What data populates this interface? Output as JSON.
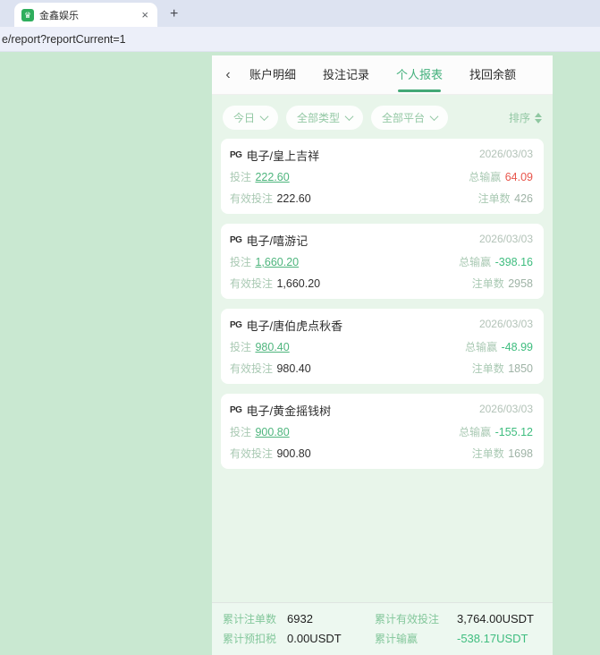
{
  "browser": {
    "tab_title": "金鑫娱乐",
    "favicon_glyph": "♛",
    "close_label": "×",
    "new_tab_label": "+",
    "url": "e/report?reportCurrent=1"
  },
  "header": {
    "back_icon": "‹",
    "tabs": [
      {
        "label": "账户明细"
      },
      {
        "label": "投注记录"
      },
      {
        "label": "个人报表"
      },
      {
        "label": "找回余额"
      }
    ],
    "active_tab": "个人报表"
  },
  "filters": {
    "date_filter": "今日",
    "type_filter": "全部类型",
    "platform_filter": "全部平台",
    "sort_label": "排序"
  },
  "cards": [
    {
      "provider": "PG",
      "title": "电子/皇上吉祥",
      "date": "2026/03/03",
      "bet_label": "投注",
      "bet": "222.60",
      "winloss_label": "总输赢",
      "winloss": "64.09",
      "valid_label": "有效投注",
      "valid": "222.60",
      "orders_label": "注单数",
      "orders": "426"
    },
    {
      "provider": "PG",
      "title": "电子/嘻游记",
      "date": "2026/03/03",
      "bet_label": "投注",
      "bet": "1,660.20",
      "winloss_label": "总输赢",
      "winloss": "-398.16",
      "valid_label": "有效投注",
      "valid": "1,660.20",
      "orders_label": "注单数",
      "orders": "2958"
    },
    {
      "provider": "PG",
      "title": "电子/唐伯虎点秋香",
      "date": "2026/03/03",
      "bet_label": "投注",
      "bet": "980.40",
      "winloss_label": "总输赢",
      "winloss": "-48.99",
      "valid_label": "有效投注",
      "valid": "980.40",
      "orders_label": "注单数",
      "orders": "1850"
    },
    {
      "provider": "PG",
      "title": "电子/黄金摇钱树",
      "date": "2026/03/03",
      "bet_label": "投注",
      "bet": "900.80",
      "winloss_label": "总输赢",
      "winloss": "-155.12",
      "valid_label": "有效投注",
      "valid": "900.80",
      "orders_label": "注单数",
      "orders": "1698"
    }
  ],
  "summary": {
    "items": [
      {
        "label": "累计注单数",
        "value": "6932"
      },
      {
        "label": "累计有效投注",
        "value": "3,764.00USDT"
      },
      {
        "label": "累计预扣税",
        "value": "0.00USDT"
      },
      {
        "label": "累计输赢",
        "value": "-538.17USDT"
      }
    ]
  },
  "colors": {
    "accent_green": "#43b07c",
    "positive_red": "#e8564c",
    "negative_green": "#3fbd7f",
    "page_bg": "#c9e8d1",
    "column_bg": "#e8f5ea"
  }
}
